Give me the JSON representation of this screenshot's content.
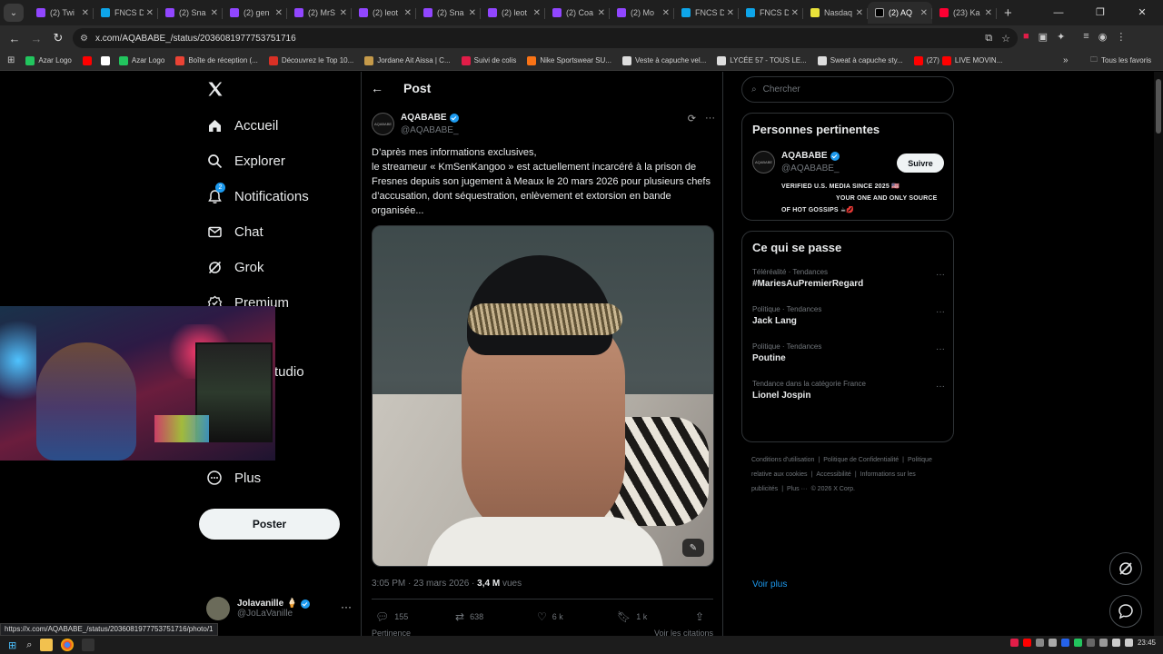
{
  "browser": {
    "tabs": [
      {
        "label": "(2) Twi",
        "color": "#9146ff"
      },
      {
        "label": "FNCS D",
        "color": "#0ea5e9"
      },
      {
        "label": "(2) Sna",
        "color": "#9146ff"
      },
      {
        "label": "(2) gen",
        "color": "#9146ff"
      },
      {
        "label": "(2) MrS",
        "color": "#9146ff"
      },
      {
        "label": "(2) leot",
        "color": "#9146ff"
      },
      {
        "label": "(2) Sna",
        "color": "#9146ff"
      },
      {
        "label": "(2) leot",
        "color": "#9146ff"
      },
      {
        "label": "(2) Coa",
        "color": "#9146ff"
      },
      {
        "label": "(2) Mo",
        "color": "#9146ff"
      },
      {
        "label": "FNCS D",
        "color": "#0ea5e9"
      },
      {
        "label": "FNCS D",
        "color": "#0ea5e9"
      },
      {
        "label": "Nasdaq",
        "color": "#e9e23a"
      },
      {
        "label": "(2) AQ",
        "color": "#000000"
      },
      {
        "label": "(23) Ka",
        "color": "#ff0033"
      }
    ],
    "url": "x.com/AQABABE_/status/2036081977753751716",
    "bookmarks": [
      {
        "label": "Azar Logo",
        "color": "#22c55e"
      },
      {
        "label": "",
        "color": "#ff0000"
      },
      {
        "label": "",
        "color": "#ffffff"
      },
      {
        "label": "Azar Logo",
        "color": "#22c55e"
      },
      {
        "label": "Boîte de réception (...",
        "color": "#ea4335"
      },
      {
        "label": "Découvrez le Top 10...",
        "color": "#d93025"
      },
      {
        "label": "Jordane Ait Aissa | C...",
        "color": "#c59a4a"
      },
      {
        "label": "Suivi de colis",
        "color": "#e11d48"
      },
      {
        "label": "Nike Sportswear SU...",
        "color": "#f97316"
      },
      {
        "label": "Veste à capuche vel...",
        "color": "#dddddd"
      },
      {
        "label": "LYCÉE 57 - TOUS LE...",
        "color": "#dddddd"
      },
      {
        "label": "Sweat à capuche sty...",
        "color": "#dddddd"
      },
      {
        "label": "(27)",
        "color": "#ff0000"
      },
      {
        "label": "LIVE MOVIN...",
        "color": "#ff0000"
      }
    ],
    "bookmarks_more": "»",
    "all_bookmarks": "Tous les favoris",
    "status_url": "https://x.com/AQABABE_/status/2036081977753751716/photo/1"
  },
  "nav": {
    "items": [
      {
        "label": "Accueil",
        "icon": "home-icon"
      },
      {
        "label": "Explorer",
        "icon": "search-icon"
      },
      {
        "label": "Notifications",
        "icon": "bell-icon",
        "badge": "2"
      },
      {
        "label": "Chat",
        "icon": "mail-icon"
      },
      {
        "label": "Grok",
        "icon": "grok-icon"
      },
      {
        "label": "Premium",
        "icon": "premium-icon"
      }
    ],
    "studio_label": "Studio",
    "more_label": "Plus",
    "post_button": "Poster",
    "account": {
      "name": "Jolavanille",
      "handle": "@JoLaVanille"
    }
  },
  "post": {
    "header": "Post",
    "author_name": "AQABABE",
    "author_handle": "@AQABABE_",
    "avatar_text": "AQABABE",
    "text_line1": "D’après mes informations exclusives,",
    "text_body": "le streameur « KmSenKangoo » est actuellement incarcéré à la prison de Fresnes depuis son jugement à Meaux le 20 mars 2026 pour plusieurs chefs d’accusation, dont séquestration, enlèvement et extorsion en bande organisée...",
    "time": "3:05 PM · 23 mars 2026 · ",
    "views_count": "3,4 M",
    "views_label": " vues",
    "replies": "155",
    "reposts": "638",
    "likes": "6 k",
    "bookmarks": "1 k",
    "relevance": "Pertinence",
    "see_quotes": "Voir les citations"
  },
  "sidebar": {
    "search_placeholder": "Chercher",
    "relevant_title": "Personnes pertinentes",
    "rel_name": "AQABABE",
    "rel_handle": "@AQABABE_",
    "follow": "Suivre",
    "bio_line1": "VERIFIED U.S. MEDIA SINCE 2025 🇺🇸",
    "bio_line2": "YOUR ONE AND ONLY SOURCE",
    "bio_line3": "OF HOT GOSSIPS ☕💋",
    "trending_title": "Ce qui se passe",
    "trends": [
      {
        "category": "Téléréalité · Tendances",
        "name": "#MariesAuPremierRegard"
      },
      {
        "category": "Politique · Tendances",
        "name": "Jack Lang"
      },
      {
        "category": "Politique · Tendances",
        "name": "Poutine"
      },
      {
        "category": "Tendance dans la catégorie France",
        "name": "Lionel Jospin"
      }
    ],
    "see_more": "Voir plus",
    "footer": [
      "Conditions d'utilisation",
      "|",
      "Politique de Confidentialité",
      "|",
      "Politique relative aux cookies",
      "|",
      "Accessibilité",
      "|",
      "Informations sur les publicités",
      "|",
      "Plus ···",
      "© 2026 X Corp."
    ]
  },
  "taskbar": {
    "time": "23:45"
  },
  "colors": {
    "accent": "#1d9bf0",
    "background": "#000000",
    "border": "#2f3336",
    "muted": "#71767b"
  }
}
